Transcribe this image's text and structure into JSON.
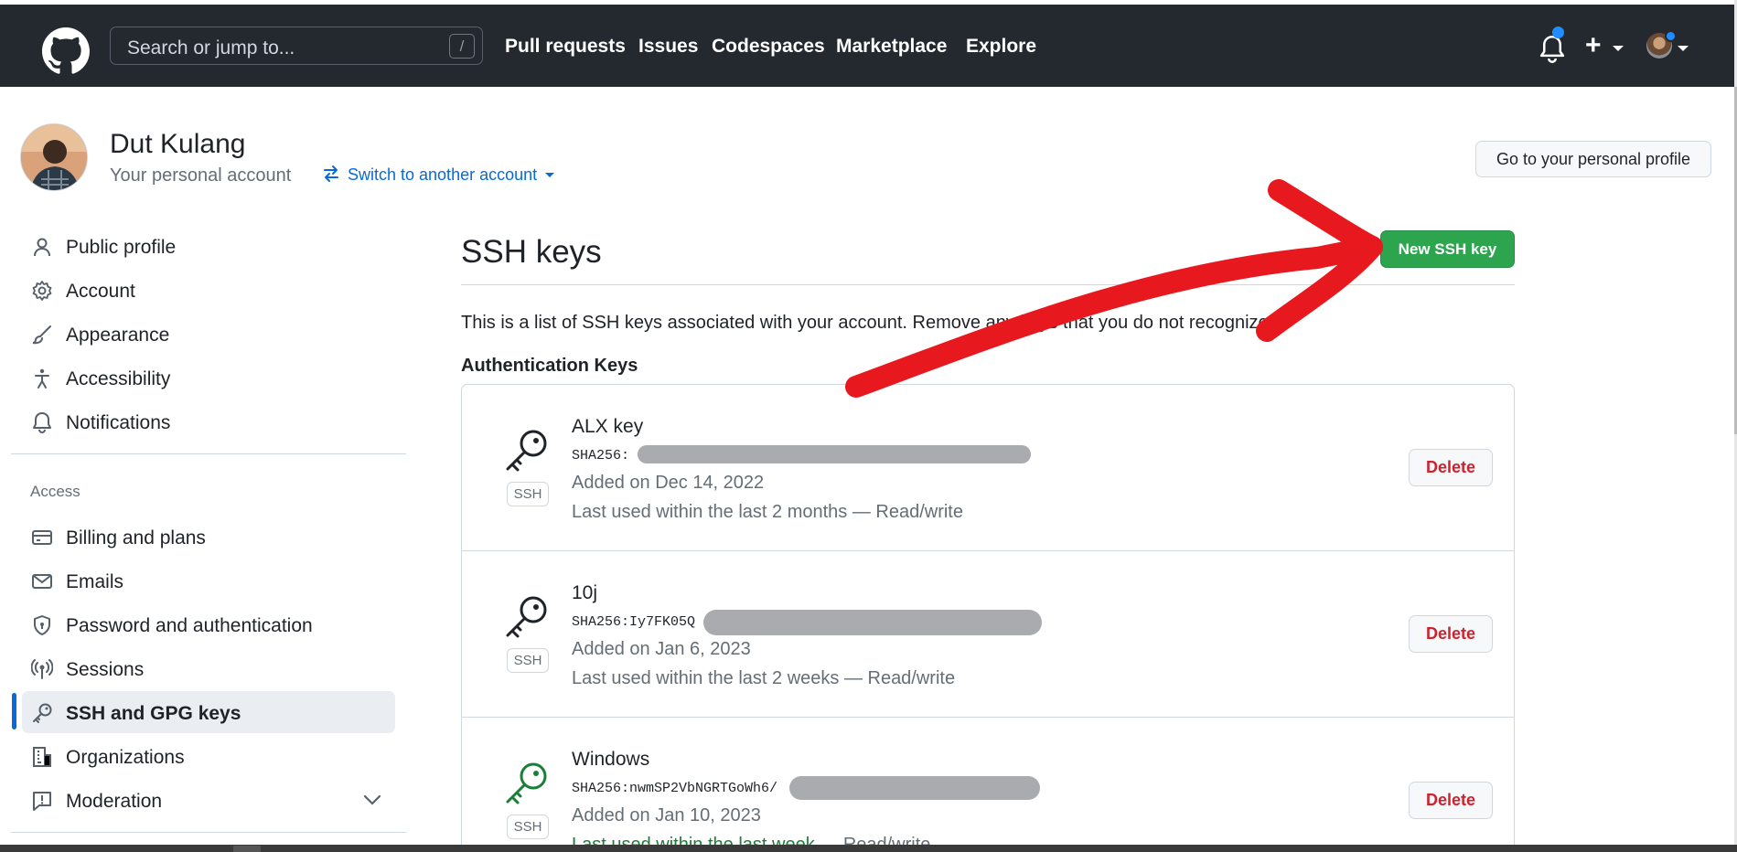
{
  "header": {
    "search_placeholder": "Search or jump to...",
    "search_shortcut": "/",
    "nav": [
      "Pull requests",
      "Issues",
      "Codespaces",
      "Marketplace",
      "Explore"
    ],
    "plus_icon": "+",
    "accent_color": "#1f8dff"
  },
  "profile": {
    "name": "Dut Kulang",
    "subtitle": "Your personal account",
    "switch_label": "Switch to another account",
    "go_profile_label": "Go to your personal profile"
  },
  "sidebar": {
    "items": [
      {
        "label": "Public profile",
        "icon": "person-icon"
      },
      {
        "label": "Account",
        "icon": "gear-icon"
      },
      {
        "label": "Appearance",
        "icon": "paintbrush-icon"
      },
      {
        "label": "Accessibility",
        "icon": "accessibility-icon"
      },
      {
        "label": "Notifications",
        "icon": "bell-icon"
      }
    ],
    "access_heading": "Access",
    "access_items": [
      {
        "label": "Billing and plans",
        "icon": "credit-card-icon"
      },
      {
        "label": "Emails",
        "icon": "mail-icon"
      },
      {
        "label": "Password and authentication",
        "icon": "shield-lock-icon"
      },
      {
        "label": "Sessions",
        "icon": "broadcast-icon"
      },
      {
        "label": "SSH and GPG keys",
        "icon": "key-icon",
        "active": true
      },
      {
        "label": "Organizations",
        "icon": "organization-icon"
      },
      {
        "label": "Moderation",
        "icon": "report-icon"
      }
    ]
  },
  "main": {
    "title": "SSH keys",
    "new_key_label": "New SSH key",
    "intro": "This is a list of SSH keys associated with your account. Remove any keys that you do not recognize.",
    "auth_heading": "Authentication Keys",
    "keys": [
      {
        "name": "ALX key",
        "fingerprint": "SHA256:",
        "added": "Added on Dec 14, 2022",
        "used": "Last used within the last 2 months — Read/write",
        "badge": "SSH",
        "delete_label": "Delete"
      },
      {
        "name": "10j",
        "fingerprint": "SHA256:Iy7FK05Q",
        "added": "Added on Jan 6, 2023",
        "used": "Last used within the last 2 weeks — Read/write",
        "badge": "SSH",
        "delete_label": "Delete"
      },
      {
        "name": "Windows",
        "fingerprint": "SHA256:nwmSP2VbNGRTGoWh6/",
        "added": "Added on Jan 10, 2023",
        "used_recent": "Last used within the last week",
        "used_rest": " — Read/write",
        "badge": "SSH",
        "delete_label": "Delete"
      }
    ]
  },
  "annotation": {
    "arrow_color": "#e8191e"
  },
  "colors": {
    "header_bg": "#24292f",
    "primary_button": "#2da44e",
    "danger": "#cf222e",
    "link": "#0969da"
  }
}
